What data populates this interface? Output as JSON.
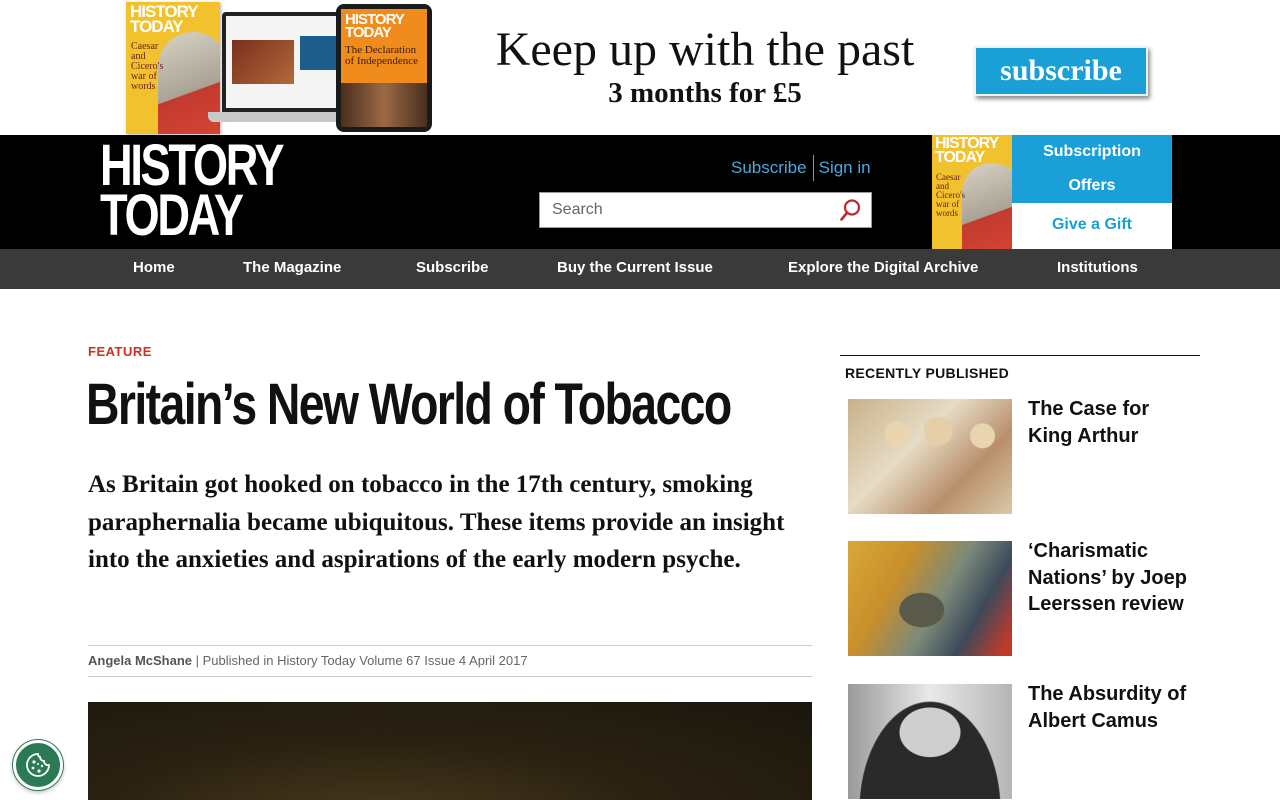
{
  "banner": {
    "cover_masthead": "HISTORY TODAY",
    "cover_caption": "Caesar and Cicero's war of words",
    "tablet_masthead": "HISTORY TODAY",
    "tablet_caption": "The Declaration of Independence",
    "headline": "Keep up with the past",
    "subline": "3 months for £5",
    "subscribe_label": "subscribe"
  },
  "header": {
    "logo_line1": "HISTORY",
    "logo_line2": "TODAY",
    "subscribe_link": "Subscribe",
    "signin_link": "Sign in",
    "search_placeholder": "Search",
    "cover_masthead": "HISTORY TODAY",
    "cover_caption": "Caesar and Cicero's war of words",
    "offers_line1": "Subscription",
    "offers_line2": "Offers",
    "gift_label": "Give a Gift",
    "accent_color": "#1aa0d6"
  },
  "nav": {
    "items": [
      {
        "label": "Home"
      },
      {
        "label": "The Magazine"
      },
      {
        "label": "Subscribe"
      },
      {
        "label": "Buy the Current Issue"
      },
      {
        "label": "Explore the Digital Archive"
      },
      {
        "label": "Institutions"
      }
    ]
  },
  "article": {
    "kicker": "FEATURE",
    "title": "Britain’s New World of Tobacco",
    "standfirst": "As Britain got hooked on tobacco in the 17th century, smoking paraphernalia became ubiquitous. These items provide an insight into the anxieties and aspirations of the early modern psyche.",
    "author": "Angela McShane",
    "published": " | Published in History Today Volume 67 Issue 4 April 2017",
    "kicker_color": "#d0301f"
  },
  "sidebar": {
    "heading": "RECENTLY PUBLISHED",
    "items": [
      {
        "title": "The Case for King Arthur"
      },
      {
        "title": "‘Charismatic Nations’ by Joep Leerssen review"
      },
      {
        "title": "The Absurdity of Albert Camus"
      }
    ]
  },
  "icons": {
    "search": "search-icon",
    "cookie": "cookie-icon"
  }
}
